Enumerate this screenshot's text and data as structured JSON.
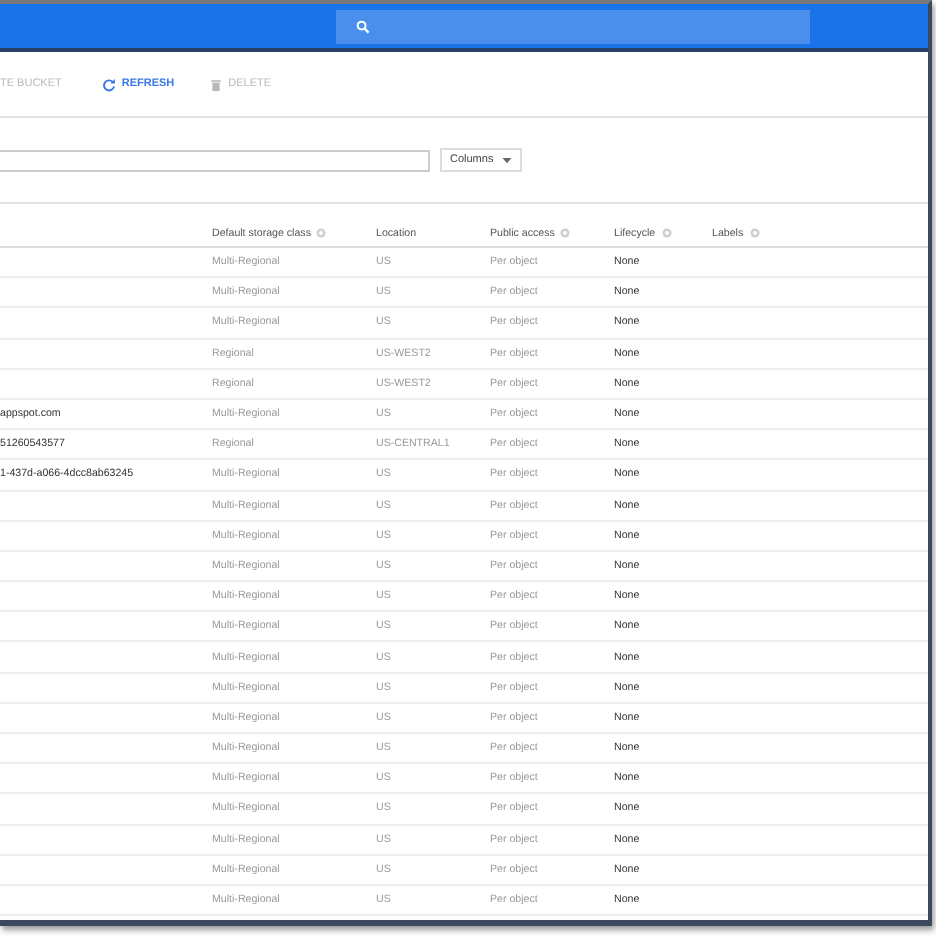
{
  "toolbar": [
    {
      "kind": "create",
      "label": "TE BUCKET",
      "disabled": true
    },
    {
      "kind": "refresh",
      "label": "REFRESH",
      "disabled": false
    },
    {
      "kind": "delete",
      "label": "DELETE",
      "disabled": true
    }
  ],
  "filter": {
    "columns_button": "Columns"
  },
  "table": {
    "columns": [
      {
        "label": "Default storage class",
        "help": true
      },
      {
        "label": "Location",
        "help": false
      },
      {
        "label": "Public access",
        "help": true
      },
      {
        "label": "Lifecycle",
        "help": true
      },
      {
        "label": "Labels",
        "help": true
      }
    ],
    "rows": [
      {
        "name": "",
        "storage_class": "Multi-Regional",
        "location": "US",
        "public_access": "Per object",
        "lifecycle": "None"
      },
      {
        "name": "",
        "storage_class": "Multi-Regional",
        "location": "US",
        "public_access": "Per object",
        "lifecycle": "None"
      },
      {
        "name": "",
        "storage_class": "Multi-Regional",
        "location": "US",
        "public_access": "Per object",
        "lifecycle": "None"
      },
      {
        "name": "",
        "storage_class": "Regional",
        "location": "US-WEST2",
        "public_access": "Per object",
        "lifecycle": "None"
      },
      {
        "name": "",
        "storage_class": "Regional",
        "location": "US-WEST2",
        "public_access": "Per object",
        "lifecycle": "None"
      },
      {
        "name": "appspot.com",
        "storage_class": "Multi-Regional",
        "location": "US",
        "public_access": "Per object",
        "lifecycle": "None"
      },
      {
        "name": "51260543577",
        "storage_class": "Regional",
        "location": "US-CENTRAL1",
        "public_access": "Per object",
        "lifecycle": "None"
      },
      {
        "name": "1-437d-a066-4dcc8ab63245",
        "storage_class": "Multi-Regional",
        "location": "US",
        "public_access": "Per object",
        "lifecycle": "None"
      },
      {
        "name": "",
        "storage_class": "Multi-Regional",
        "location": "US",
        "public_access": "Per object",
        "lifecycle": "None"
      },
      {
        "name": "",
        "storage_class": "Multi-Regional",
        "location": "US",
        "public_access": "Per object",
        "lifecycle": "None"
      },
      {
        "name": "",
        "storage_class": "Multi-Regional",
        "location": "US",
        "public_access": "Per object",
        "lifecycle": "None"
      },
      {
        "name": "",
        "storage_class": "Multi-Regional",
        "location": "US",
        "public_access": "Per object",
        "lifecycle": "None"
      },
      {
        "name": "",
        "storage_class": "Multi-Regional",
        "location": "US",
        "public_access": "Per object",
        "lifecycle": "None"
      },
      {
        "name": "",
        "storage_class": "Multi-Regional",
        "location": "US",
        "public_access": "Per object",
        "lifecycle": "None"
      },
      {
        "name": "",
        "storage_class": "Multi-Regional",
        "location": "US",
        "public_access": "Per object",
        "lifecycle": "None"
      },
      {
        "name": "",
        "storage_class": "Multi-Regional",
        "location": "US",
        "public_access": "Per object",
        "lifecycle": "None"
      },
      {
        "name": "",
        "storage_class": "Multi-Regional",
        "location": "US",
        "public_access": "Per object",
        "lifecycle": "None"
      },
      {
        "name": "",
        "storage_class": "Multi-Regional",
        "location": "US",
        "public_access": "Per object",
        "lifecycle": "None"
      },
      {
        "name": "",
        "storage_class": "Multi-Regional",
        "location": "US",
        "public_access": "Per object",
        "lifecycle": "None"
      },
      {
        "name": "",
        "storage_class": "Multi-Regional",
        "location": "US",
        "public_access": "Per object",
        "lifecycle": "None"
      },
      {
        "name": "",
        "storage_class": "Multi-Regional",
        "location": "US",
        "public_access": "Per object",
        "lifecycle": "None"
      },
      {
        "name": "",
        "storage_class": "Multi-Regional",
        "location": "US",
        "public_access": "Per object",
        "lifecycle": "None"
      }
    ]
  }
}
